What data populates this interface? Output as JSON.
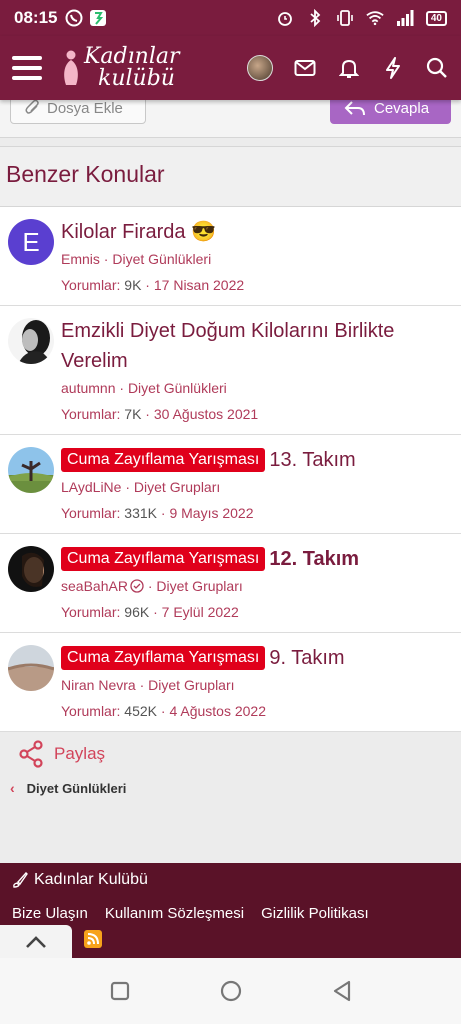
{
  "status": {
    "time": "08:15",
    "battery": "40"
  },
  "header": {
    "logo_line1": "Kadınlar",
    "logo_line2": "kulübü"
  },
  "actions": {
    "attach_label": "Dosya Ekle",
    "reply_label": "Cevapla"
  },
  "similar": {
    "title": "Benzer Konular",
    "stats_label": "Yorumlar:",
    "threads": [
      {
        "avatar_letter": "E",
        "title": "Kilolar Firarda 😎",
        "author": "Emnis",
        "forum": "Diyet Günlükleri",
        "replies": "9K",
        "date": "17 Nisan 2022"
      },
      {
        "title": "Emzikli Diyet Doğum Kilolarını Birlikte Verelim",
        "author": "autumnn",
        "forum": "Diyet Günlükleri",
        "replies": "7K",
        "date": "30 Ağustos 2021"
      },
      {
        "prefix": "Cuma Zayıflama Yarışması",
        "title": "13. Takım",
        "author": "LAydLiNe",
        "forum": "Diyet Grupları",
        "replies": "331K",
        "date": "9 Mayıs 2022"
      },
      {
        "prefix": "Cuma Zayıflama Yarışması",
        "title": "12. Takım",
        "author": "seaBahAR",
        "forum": "Diyet Grupları",
        "replies": "96K",
        "date": "7 Eylül 2022"
      },
      {
        "prefix": "Cuma Zayıflama Yarışması",
        "title": "9. Takım",
        "author": "Niran Nevra",
        "forum": "Diyet Grupları",
        "replies": "452K",
        "date": "4 Ağustos 2022"
      }
    ]
  },
  "share_label": "Paylaş",
  "breadcrumb": "Diyet Günlükleri",
  "footer": {
    "brand": "Kadınlar Kulübü",
    "links": [
      "Bize Ulaşın",
      "Kullanım Sözleşmesi",
      "Gizlilik Politikası"
    ]
  },
  "colors": {
    "brand": "#7a1c3e",
    "prefix": "#e0001b",
    "reply": "#a866c4",
    "footer": "#5a1228"
  }
}
